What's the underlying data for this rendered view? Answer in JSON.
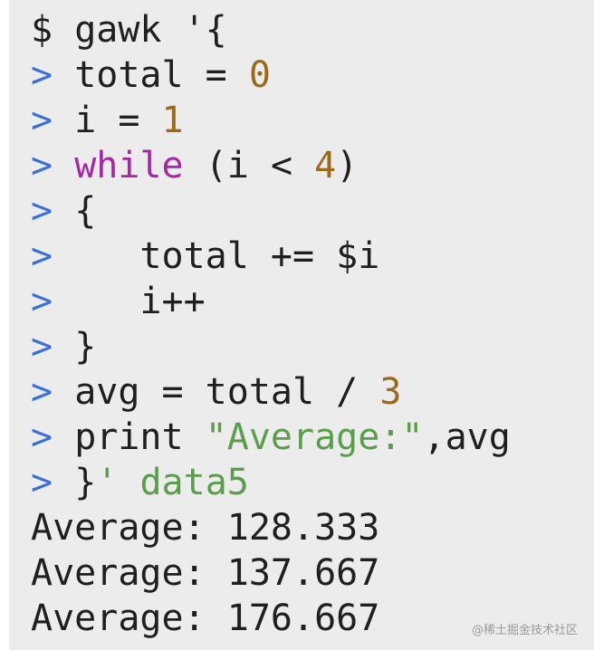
{
  "terminal": {
    "lines": [
      {
        "prompt": "$",
        "parts": [
          {
            "t": "gawk '{",
            "k": "plain"
          }
        ]
      },
      {
        "prompt": ">",
        "parts": [
          {
            "t": "total = ",
            "k": "plain"
          },
          {
            "t": "0",
            "k": "num"
          }
        ]
      },
      {
        "prompt": ">",
        "parts": [
          {
            "t": "i = ",
            "k": "plain"
          },
          {
            "t": "1",
            "k": "num"
          }
        ]
      },
      {
        "prompt": ">",
        "parts": [
          {
            "t": "while",
            "k": "kw"
          },
          {
            "t": " (i < ",
            "k": "plain"
          },
          {
            "t": "4",
            "k": "num"
          },
          {
            "t": ")",
            "k": "plain"
          }
        ]
      },
      {
        "prompt": ">",
        "parts": [
          {
            "t": "{",
            "k": "plain"
          }
        ]
      },
      {
        "prompt": ">",
        "parts": [
          {
            "t": "   total += $i",
            "k": "plain"
          }
        ]
      },
      {
        "prompt": ">",
        "parts": [
          {
            "t": "   i++",
            "k": "plain"
          }
        ]
      },
      {
        "prompt": ">",
        "parts": [
          {
            "t": "}",
            "k": "plain"
          }
        ]
      },
      {
        "prompt": ">",
        "parts": [
          {
            "t": "avg = total / ",
            "k": "plain"
          },
          {
            "t": "3",
            "k": "num"
          }
        ]
      },
      {
        "prompt": ">",
        "parts": [
          {
            "t": "print ",
            "k": "plain"
          },
          {
            "t": "\"Average:\"",
            "k": "str"
          },
          {
            "t": ",avg",
            "k": "plain"
          }
        ]
      },
      {
        "prompt": ">",
        "parts": [
          {
            "t": "}",
            "k": "plain"
          },
          {
            "t": "' data5",
            "k": "str"
          }
        ]
      },
      {
        "prompt": "",
        "parts": [
          {
            "t": "Average: 128.333",
            "k": "plain"
          }
        ]
      },
      {
        "prompt": "",
        "parts": [
          {
            "t": "Average: 137.667",
            "k": "plain"
          }
        ]
      },
      {
        "prompt": "",
        "parts": [
          {
            "t": "Average: 176.667",
            "k": "plain"
          }
        ]
      }
    ]
  },
  "watermark": "@稀土掘金技术社区"
}
